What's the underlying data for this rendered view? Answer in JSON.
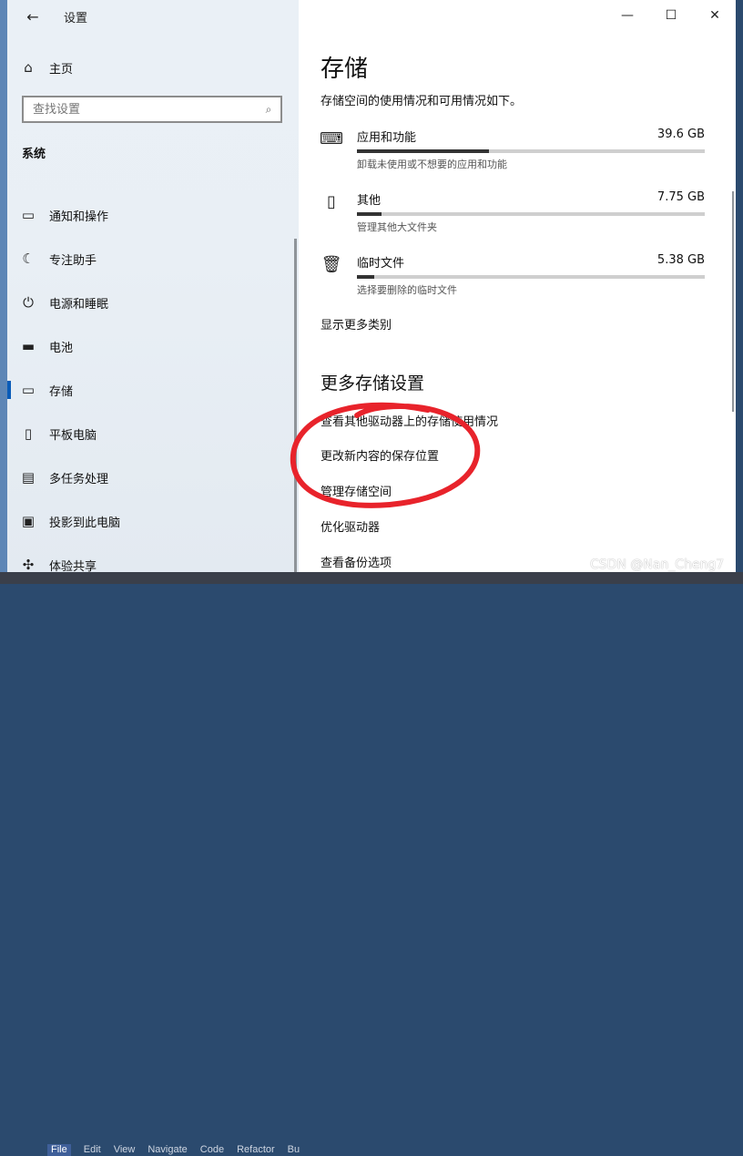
{
  "window": {
    "title": "设置",
    "back_icon": "arrow-left-icon"
  },
  "sidebar": {
    "home_label": "主页",
    "search_placeholder": "查找设置",
    "section_label": "系统",
    "items": [
      {
        "label": "通知和操作",
        "icon": "message-icon"
      },
      {
        "label": "专注助手",
        "icon": "moon-icon"
      },
      {
        "label": "电源和睡眠",
        "icon": "power-icon"
      },
      {
        "label": "电池",
        "icon": "battery-icon"
      },
      {
        "label": "存储",
        "icon": "storage-icon",
        "selected": true
      },
      {
        "label": "平板电脑",
        "icon": "tablet-icon"
      },
      {
        "label": "多任务处理",
        "icon": "multitask-icon"
      },
      {
        "label": "投影到此电脑",
        "icon": "project-icon"
      },
      {
        "label": "体验共享",
        "icon": "share-icon"
      }
    ]
  },
  "content": {
    "title": "存储",
    "subtitle": "存储空间的使用情况和可用情况如下。",
    "storage_items": [
      {
        "name": "应用和功能",
        "size": "39.6 GB",
        "desc": "卸载未使用或不想要的应用和功能",
        "fraction": 0.38,
        "icon": "keyboard-icon"
      },
      {
        "name": "其他",
        "size": "7.75 GB",
        "desc": "管理其他大文件夹",
        "fraction": 0.07,
        "icon": "folder-icon"
      },
      {
        "name": "临时文件",
        "size": "5.38 GB",
        "desc": "选择要删除的临时文件",
        "fraction": 0.05,
        "icon": "trash-icon"
      }
    ],
    "show_more": "显示更多类别",
    "more_settings_title": "更多存储设置",
    "more_links": [
      "查看其他驱动器上的存储使用情况",
      "更改新内容的保存位置",
      "管理存储空间",
      "优化驱动器",
      "查看备份选项"
    ]
  },
  "background_menu": [
    "File",
    "Edit",
    "View",
    "Navigate",
    "Code",
    "Refactor",
    "Bu"
  ],
  "watermark": "CSDN @Nan_Cheng7",
  "colors": {
    "accent": "#0a5cb8",
    "annotation": "#e8232b"
  }
}
